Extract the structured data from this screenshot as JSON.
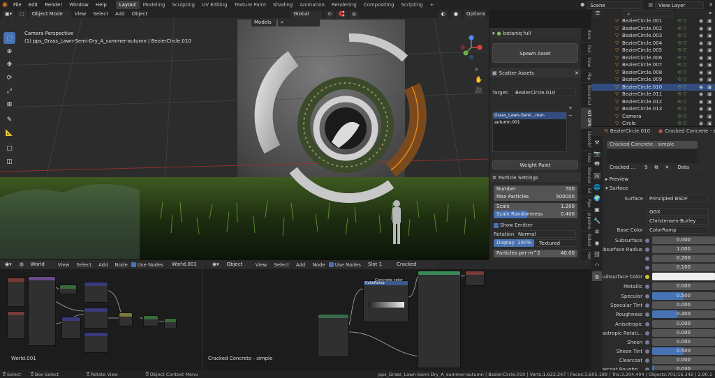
{
  "menu": [
    "File",
    "Edit",
    "Render",
    "Window",
    "Help"
  ],
  "workspaces": [
    {
      "label": "Layout",
      "active": true
    },
    {
      "label": "Modeling",
      "active": false
    },
    {
      "label": "Sculpting",
      "active": false
    },
    {
      "label": "UV Editing",
      "active": false
    },
    {
      "label": "Texture Paint",
      "active": false
    },
    {
      "label": "Shading",
      "active": false
    },
    {
      "label": "Animation",
      "active": false
    },
    {
      "label": "Rendering",
      "active": false
    },
    {
      "label": "Compositing",
      "active": false
    },
    {
      "label": "Scripting",
      "active": false
    }
  ],
  "scene_label": "Scene",
  "view_layer_label": "View Layer",
  "viewport": {
    "mode": "Object Mode",
    "menus": [
      "View",
      "Select",
      "Add",
      "Object"
    ],
    "orientation": "Global",
    "options": "Options",
    "collection": "Models",
    "camera_title": "Camera Perspective",
    "camera_subtitle": "(1) pps_Grass_Lawn-Semi-Dry_A_summer-autumn | BezierCircle.010"
  },
  "npanel": {
    "addon": "botaniq full",
    "spawn": "Spawn Asset",
    "scatter": "Scatter Assets",
    "target_label": "Target:",
    "target_value": "BezierCircle.010",
    "system_item": "Grass_Lawn-Semi...mer-autumn.001",
    "weight_paint": "Weight Paint",
    "particle_settings": "Particle Settings",
    "number_label": "Number",
    "number_value": "700",
    "max_label": "Max Particles",
    "max_value": "500000",
    "scale_label": "Scale",
    "scale_value": "1.200",
    "scale_rand_label": "Scale Randomness",
    "scale_rand_value": "0.400",
    "show_emitter": "Show Emitter",
    "rotation_label": "Rotation:",
    "rotation_value": "Normal",
    "display_label": "Display",
    "display_value": "100%",
    "display_mode": "Textured",
    "ppm_label": "Particles per m^2",
    "ppm_value": "40.00"
  },
  "ntabs": [
    "Item",
    "Tool",
    "View",
    "Pbp",
    "BezierCut",
    "KIT OPS",
    "SketchF",
    "Crea",
    "Blender",
    "Ed",
    "Pipe",
    "pipeline",
    "Baked",
    "Hard",
    "Rogues",
    "Hlt",
    "Anti",
    "pbrgips"
  ],
  "outliner": [
    {
      "name": "BezierCircle.001",
      "sel": false
    },
    {
      "name": "BezierCircle.002",
      "sel": false
    },
    {
      "name": "BezierCircle.003",
      "sel": false
    },
    {
      "name": "BezierCircle.004",
      "sel": false
    },
    {
      "name": "BezierCircle.005",
      "sel": false
    },
    {
      "name": "BezierCircle.006",
      "sel": false
    },
    {
      "name": "BezierCircle.007",
      "sel": false
    },
    {
      "name": "BezierCircle.008",
      "sel": false
    },
    {
      "name": "BezierCircle.009",
      "sel": false
    },
    {
      "name": "BezierCircle.010",
      "sel": true
    },
    {
      "name": "BezierCircle.011",
      "sel": false
    },
    {
      "name": "BezierCircle.012",
      "sel": false
    },
    {
      "name": "BezierCircle.013",
      "sel": false
    },
    {
      "name": "Camera",
      "sel": false
    },
    {
      "name": "Circle",
      "sel": false
    }
  ],
  "properties": {
    "object": "BezierCircle.010",
    "material_hdr": "Cracked Concrete - simple",
    "slot": "Cracked Concrete - simple",
    "mat_short": "Cracked ...",
    "users": "9",
    "data": "Data",
    "preview": "Preview",
    "surface_sec": "Surface",
    "surface_label": "Surface",
    "surface_value": "Principled BSDF",
    "distribution": "GGX",
    "subsurface_method": "Christensen-Burley",
    "base_color_label": "Base Color",
    "base_color_value": "ColorRamp",
    "rows": [
      {
        "label": "Subsurface",
        "value": "0.000",
        "fill": 0
      },
      {
        "label": "Subsurface Radius",
        "value": "1.000",
        "fill": 0
      },
      {
        "label": "",
        "value": "0.200",
        "fill": 0
      },
      {
        "label": "",
        "value": "0.100",
        "fill": 0
      },
      {
        "label": "Subsurface Color",
        "value": "",
        "fill": 0
      },
      {
        "label": "Metallic",
        "value": "0.000",
        "fill": 0
      },
      {
        "label": "Specular",
        "value": "0.500",
        "fill": 0.5
      },
      {
        "label": "Specular Tint",
        "value": "0.000",
        "fill": 0
      },
      {
        "label": "Roughness",
        "value": "0.400",
        "fill": 0.4
      },
      {
        "label": "Anisotropic",
        "value": "0.000",
        "fill": 0
      },
      {
        "label": "Anisotropic Rotati...",
        "value": "0.000",
        "fill": 0
      },
      {
        "label": "Sheen",
        "value": "0.000",
        "fill": 0
      },
      {
        "label": "Sheen Tint",
        "value": "0.500",
        "fill": 0.5
      },
      {
        "label": "Clearcoat",
        "value": "0.000",
        "fill": 0
      },
      {
        "label": "Clearcoat Roughn...",
        "value": "0.030",
        "fill": 0.03
      }
    ]
  },
  "node_editor": {
    "world_type": "World",
    "menus": [
      "View",
      "Select",
      "Add",
      "Node"
    ],
    "use_nodes": "Use Nodes",
    "world": "World.001",
    "object_type": "Object",
    "slot": "Slot 1",
    "material": "Cracked Concrete - s",
    "world_label": "World.001",
    "material_label": "Cracked Concrete - simple",
    "color_node": "Concrete color"
  },
  "status": {
    "select": "Select",
    "box": "Box Select",
    "rotate": "Rotate View",
    "context": "Object Context Menu",
    "info": "pps_Grass_Lawn-Semi-Dry_A_summer-autumn | BezierCircle.010 | Verts:1,622,247 | Faces:1,605,189 | Tris:3,204,404 | Objects:701/16,342 | 2.90.1"
  }
}
